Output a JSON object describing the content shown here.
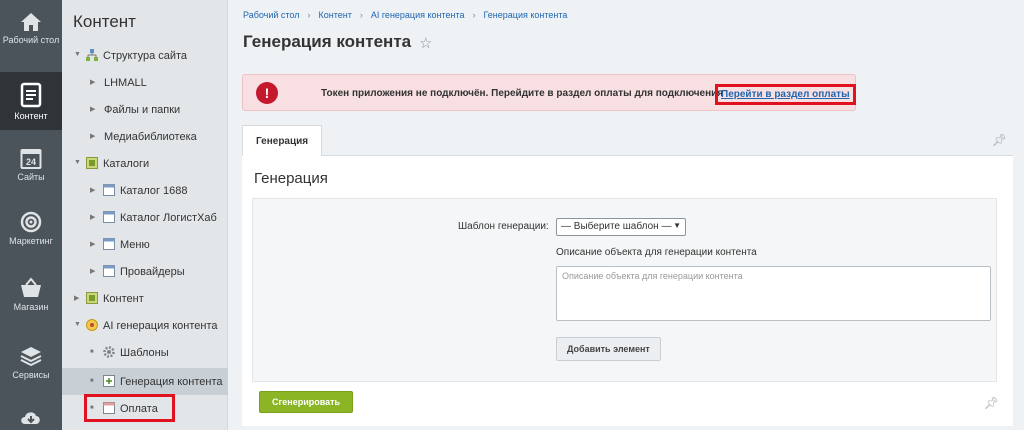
{
  "rail": {
    "items": [
      {
        "label": "Рабочий стол",
        "icon": "home-icon"
      },
      {
        "label": "Контент",
        "icon": "document-icon"
      },
      {
        "label": "Сайты",
        "icon": "calendar-icon"
      },
      {
        "label": "Маркетинг",
        "icon": "target-icon"
      },
      {
        "label": "Магазин",
        "icon": "basket-icon"
      },
      {
        "label": "Сервисы",
        "icon": "layers-icon"
      }
    ],
    "calendar_number": "24"
  },
  "tree": {
    "title": "Контент",
    "nodes": [
      {
        "label": "Структура сайта"
      },
      {
        "label": "LHMALL"
      },
      {
        "label": "Файлы и папки"
      },
      {
        "label": "Медиабиблиотека"
      },
      {
        "label": "Каталоги"
      },
      {
        "label": "Каталог 1688"
      },
      {
        "label": "Каталог ЛогистХаб"
      },
      {
        "label": "Меню"
      },
      {
        "label": "Провайдеры"
      },
      {
        "label": "Контент"
      },
      {
        "label": "AI генерация контента"
      },
      {
        "label": "Шаблоны"
      },
      {
        "label": "Генерация контента"
      },
      {
        "label": "Оплата"
      }
    ]
  },
  "breadcrumb": [
    "Рабочий стол",
    "Контент",
    "AI генерация контента",
    "Генерация контента"
  ],
  "page": {
    "title": "Генерация контента"
  },
  "alert": {
    "icon": "!",
    "text": "Токен приложения не подключён. Перейдите в раздел оплаты для подключения",
    "link": "Перейти в раздел оплаты"
  },
  "tabs": [
    {
      "label": "Генерация"
    }
  ],
  "panel": {
    "title": "Генерация",
    "template_label": "Шаблон генерации:",
    "template_value": "— Выберите шаблон —",
    "description_label": "Описание объекта для генерации контента",
    "description_placeholder": "Описание объекта для генерации контента",
    "add_button": "Добавить элемент",
    "generate_button": "Сгенерировать"
  },
  "colors": {
    "accent_link": "#2067b0",
    "alert_bg": "#f7dfe2",
    "alert_icon": "#c4182c",
    "highlight": "#e0121f",
    "generate_button": "#8bb524"
  }
}
